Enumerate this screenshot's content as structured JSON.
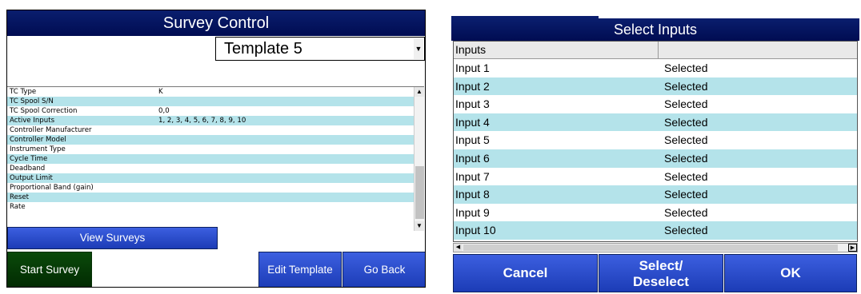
{
  "left": {
    "title": "Survey Control",
    "template_value": "Template 5",
    "properties": [
      {
        "key": "TC Type",
        "value": "K"
      },
      {
        "key": "TC Spool S/N",
        "value": ""
      },
      {
        "key": "TC Spool Correction",
        "value": "0,0"
      },
      {
        "key": "Active Inputs",
        "value": "1, 2, 3, 4, 5, 6, 7, 8, 9, 10"
      },
      {
        "key": "Controller Manufacturer",
        "value": ""
      },
      {
        "key": "Controller Model",
        "value": ""
      },
      {
        "key": "Instrument Type",
        "value": ""
      },
      {
        "key": "Cycle Time",
        "value": ""
      },
      {
        "key": "Deadband",
        "value": ""
      },
      {
        "key": "Output Limit",
        "value": ""
      },
      {
        "key": "Proportional Band (gain)",
        "value": ""
      },
      {
        "key": "Reset",
        "value": ""
      },
      {
        "key": "Rate",
        "value": ""
      }
    ],
    "buttons": {
      "view_surveys": "View Surveys",
      "start_survey": "Start Survey",
      "edit_template": "Edit Template",
      "go_back": "Go Back"
    }
  },
  "right": {
    "title": "Select Inputs",
    "header": {
      "inputs": "Inputs",
      "status": ""
    },
    "rows": [
      {
        "name": "Input 1",
        "status": "Selected"
      },
      {
        "name": "Input 2",
        "status": "Selected"
      },
      {
        "name": "Input 3",
        "status": "Selected"
      },
      {
        "name": "Input 4",
        "status": "Selected"
      },
      {
        "name": "Input 5",
        "status": "Selected"
      },
      {
        "name": "Input 6",
        "status": "Selected"
      },
      {
        "name": "Input 7",
        "status": "Selected"
      },
      {
        "name": "Input 8",
        "status": "Selected"
      },
      {
        "name": "Input 9",
        "status": "Selected"
      },
      {
        "name": "Input 10",
        "status": "Selected"
      }
    ],
    "buttons": {
      "cancel": "Cancel",
      "select_line1": "Select/",
      "select_line2": "Deselect",
      "ok": "OK"
    }
  },
  "icons": {
    "dropdown": "chevron-down-icon",
    "scroll_up": "triangle-up-icon",
    "scroll_down": "triangle-down-icon",
    "scroll_left": "triangle-left-icon",
    "scroll_right": "triangle-right-icon"
  },
  "colors": {
    "title_bar": "#0a1e6e",
    "button_blue": "#2a4ccc",
    "button_green": "#063806",
    "row_alt": "#b4e3ea"
  }
}
